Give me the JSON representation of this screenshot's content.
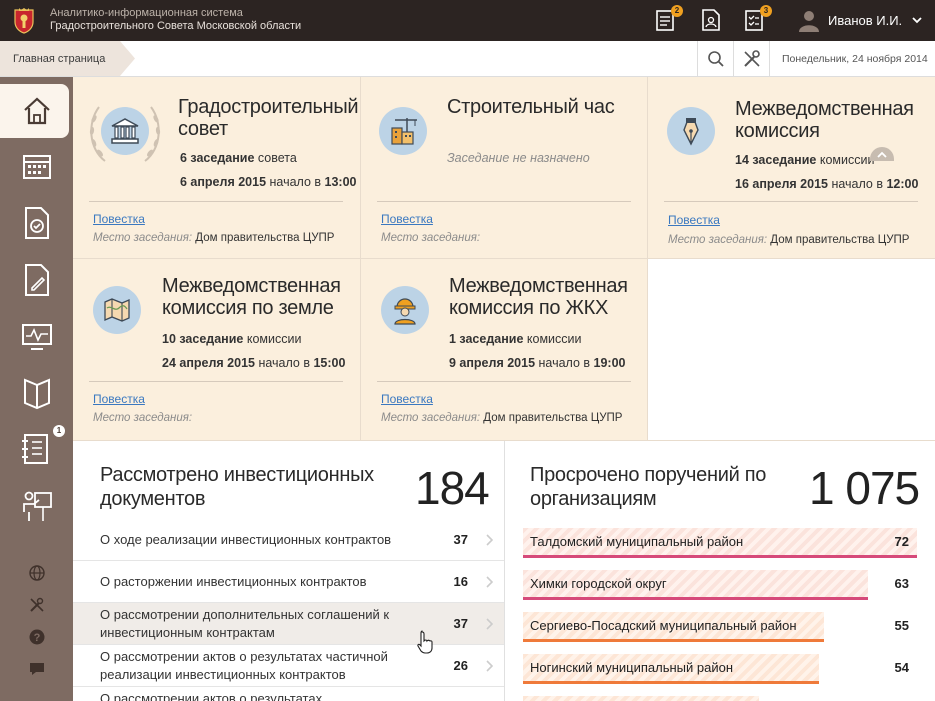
{
  "header": {
    "org_line1": "Аналитико-информационная система",
    "org_line2": "Градостроительного Совета Московской области",
    "icons": [
      {
        "name": "documents-icon",
        "badge": "2"
      },
      {
        "name": "person-document-icon",
        "badge": ""
      },
      {
        "name": "checklist-icon",
        "badge": "3"
      }
    ],
    "user_name": "Иванов И.И.",
    "colors": {
      "bar": "#2c2422",
      "badge": "#f0a020"
    }
  },
  "breadcrumb": {
    "home": "Главная страница",
    "date": "Понедельник, 24 ноября 2014"
  },
  "sidebar": {
    "items": [
      {
        "name": "home-icon",
        "active": true
      },
      {
        "name": "calendar-icon"
      },
      {
        "name": "document-check-icon"
      },
      {
        "name": "document-edit-icon"
      },
      {
        "name": "monitor-chart-icon"
      },
      {
        "name": "book-icon"
      },
      {
        "name": "checklist-icon",
        "badge": "1"
      },
      {
        "name": "presentation-icon"
      }
    ],
    "small_items": [
      {
        "name": "globe-icon"
      },
      {
        "name": "tools-icon"
      },
      {
        "name": "help-icon"
      },
      {
        "name": "chat-icon"
      }
    ]
  },
  "cards": [
    {
      "title": "Градостроительный совет",
      "meeting_num": "6 заседание",
      "meeting_suffix": " совета",
      "date": "6 апреля 2015",
      "time_prefix": " начало в ",
      "time": "13:00",
      "agenda": "Повестка",
      "place_label": "Место заседания:",
      "place": "Дом правительства ЦУПР",
      "icon": "courthouse-icon"
    },
    {
      "title": "Строительный час",
      "note": "Заседание не назначено",
      "agenda": "Повестка",
      "place_label": "Место заседания:",
      "place": "",
      "icon": "construction-icon"
    },
    {
      "title": "Межведомственная комиссия",
      "meeting_num": "14 заседание",
      "meeting_suffix": " комиссии",
      "date": "16 апреля 2015",
      "time_prefix": " начало в ",
      "time": "12:00",
      "agenda": "Повестка",
      "place_label": "Место заседания:",
      "place": "Дом правительства ЦУПР",
      "icon": "fountain-pen-icon"
    },
    {
      "title": "Межведомственная комиссия по земле",
      "meeting_num": "10 заседание",
      "meeting_suffix": " комиссии",
      "date": "24 апреля 2015",
      "time_prefix": " начало в ",
      "time": "15:00",
      "agenda": "Повестка",
      "place_label": "Место заседания:",
      "place": "",
      "icon": "map-icon"
    },
    {
      "title": "Межведомственная комиссия по ЖКХ",
      "meeting_num": "1 заседание",
      "meeting_suffix": " комиссии",
      "date": "9 апреля 2015",
      "time_prefix": " начало в ",
      "time": "19:00",
      "agenda": "Повестка",
      "place_label": "Место заседания:",
      "place": "Дом правительства ЦУПР",
      "icon": "worker-icon"
    }
  ],
  "investments": {
    "title": "Рассмотрено инвестиционных документов",
    "total": "184",
    "rows": [
      {
        "label": "О ходе реализации инвестиционных контрактов",
        "value": "37"
      },
      {
        "label": "О расторжении инвестиционных контрактов",
        "value": "16"
      },
      {
        "label": "О рассмотрении дополнительных соглашений к инвестиционным контрактам",
        "value": "37"
      },
      {
        "label": "О рассмотрении актов о результатах частичной реализации инвестиционных контрактов",
        "value": "26"
      },
      {
        "label": "О рассмотрении актов о результатах",
        "value": ""
      }
    ]
  },
  "overdue": {
    "title": "Просрочено поручений по организациям",
    "total": "1 075",
    "rows": [
      {
        "label": "Талдомский муниципальный район",
        "value": "72",
        "fraction": 1.0,
        "color": "#d64a7a"
      },
      {
        "label": "Химки городской округ",
        "value": "63",
        "fraction": 0.875,
        "color": "#d64a7a"
      },
      {
        "label": "Сергиево-Посадский муниципальный район",
        "value": "55",
        "fraction": 0.764,
        "color": "#ef7a3a"
      },
      {
        "label": "Ногинский муниципальный район",
        "value": "54",
        "fraction": 0.75,
        "color": "#ef7a3a"
      },
      {
        "label": "",
        "value": "",
        "fraction": 0.6,
        "color": "#ef7a3a"
      }
    ]
  }
}
